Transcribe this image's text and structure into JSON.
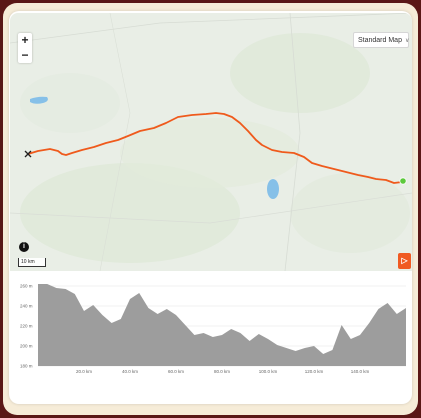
{
  "map": {
    "zoom_in_label": "+",
    "zoom_out_label": "−",
    "map_type_label": "Standard Map",
    "info_label": "i",
    "scale_label": "10 km",
    "collapse_label": "▷"
  },
  "chart_data": {
    "type": "area",
    "ylabels": [
      "260 m",
      "240 m",
      "220 m",
      "200 m",
      "180 m"
    ],
    "xlabels": [
      "20.0 km",
      "40.0 km",
      "60.0 km",
      "80.0 km",
      "100.0 km",
      "120.0 km",
      "140.0 km"
    ],
    "ylim": [
      180,
      265
    ],
    "xlim": [
      0,
      160
    ],
    "grid": true,
    "color": "#9d9d9d",
    "x": [
      0,
      4,
      8,
      12,
      16,
      20,
      24,
      28,
      32,
      36,
      40,
      44,
      48,
      52,
      56,
      60,
      64,
      68,
      72,
      76,
      80,
      84,
      88,
      92,
      96,
      100,
      104,
      108,
      112,
      116,
      120,
      124,
      128,
      132,
      136,
      140,
      144,
      148,
      152,
      156,
      160
    ],
    "y": [
      262,
      262,
      258,
      257,
      252,
      235,
      241,
      231,
      223,
      227,
      247,
      253,
      238,
      232,
      237,
      231,
      221,
      211,
      213,
      209,
      211,
      217,
      213,
      205,
      212,
      207,
      201,
      198,
      195,
      198,
      200,
      192,
      196,
      221,
      207,
      211,
      223,
      237,
      243,
      232,
      238
    ]
  },
  "colors": {
    "route": "#ef5a1c",
    "end_marker": "#5cc93c",
    "water": "#86c0e8",
    "elevation_fill": "#9d9d9d"
  }
}
